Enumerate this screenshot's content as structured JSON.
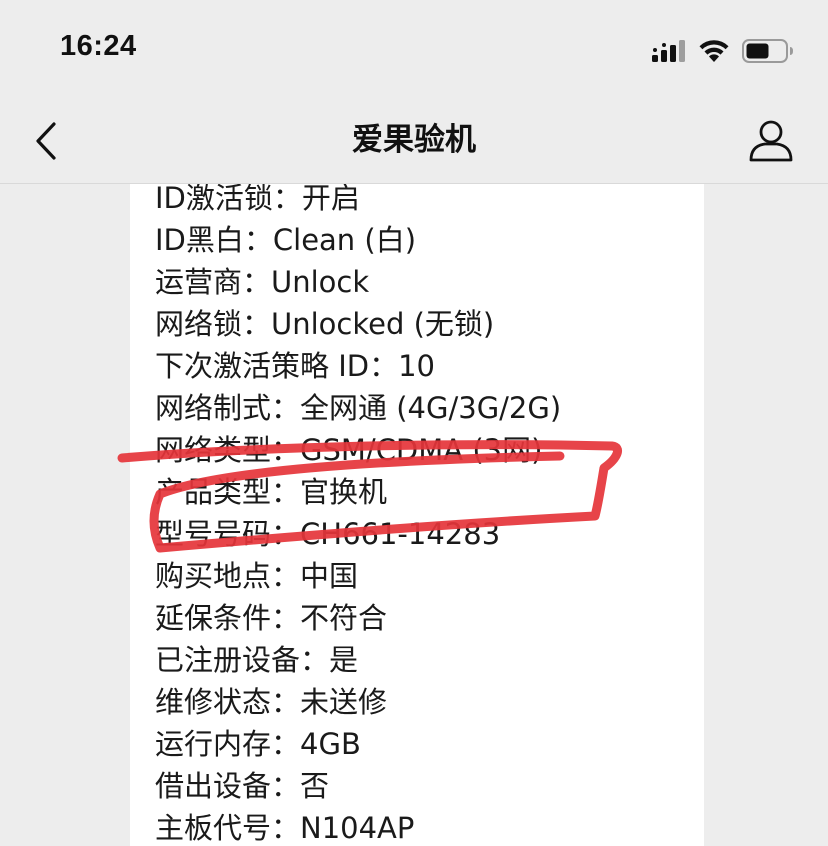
{
  "status_bar": {
    "time": "16:24",
    "icons": [
      "cellular-signal-icon",
      "wifi-icon",
      "battery-icon"
    ]
  },
  "nav": {
    "title": "爱果验机",
    "back_icon": "chevron-left-icon",
    "profile_icon": "person-icon"
  },
  "info_rows": [
    {
      "label": "ID激活锁：",
      "value": "开启"
    },
    {
      "label": "ID黑白：",
      "value": "Clean (白)"
    },
    {
      "label": "运营商：",
      "value": "Unlock"
    },
    {
      "label": "网络锁：",
      "value": "Unlocked (无锁)"
    },
    {
      "label": "下次激活策略 ID：",
      "value": "10"
    },
    {
      "label": "网络制式：",
      "value": "全网通 (4G/3G/2G)"
    },
    {
      "label": "网络类型：",
      "value": "GSM/CDMA (3网)"
    },
    {
      "label": "产品类型：",
      "value": "官换机"
    },
    {
      "label": "型号号码：",
      "value": "CH661-14283"
    },
    {
      "label": "购买地点：",
      "value": "中国"
    },
    {
      "label": "延保条件：",
      "value": "不符合"
    },
    {
      "label": "已注册设备：",
      "value": "是"
    },
    {
      "label": "维修状态：",
      "value": "未送修"
    },
    {
      "label": "运行内存：",
      "value": "4GB"
    },
    {
      "label": "借出设备：",
      "value": "否"
    },
    {
      "label": "主板代号：",
      "value": "N104AP"
    }
  ],
  "colors": {
    "background": "#ededed",
    "card": "#ffffff",
    "text": "#1a1a1a",
    "annotation": "#e5343a"
  }
}
